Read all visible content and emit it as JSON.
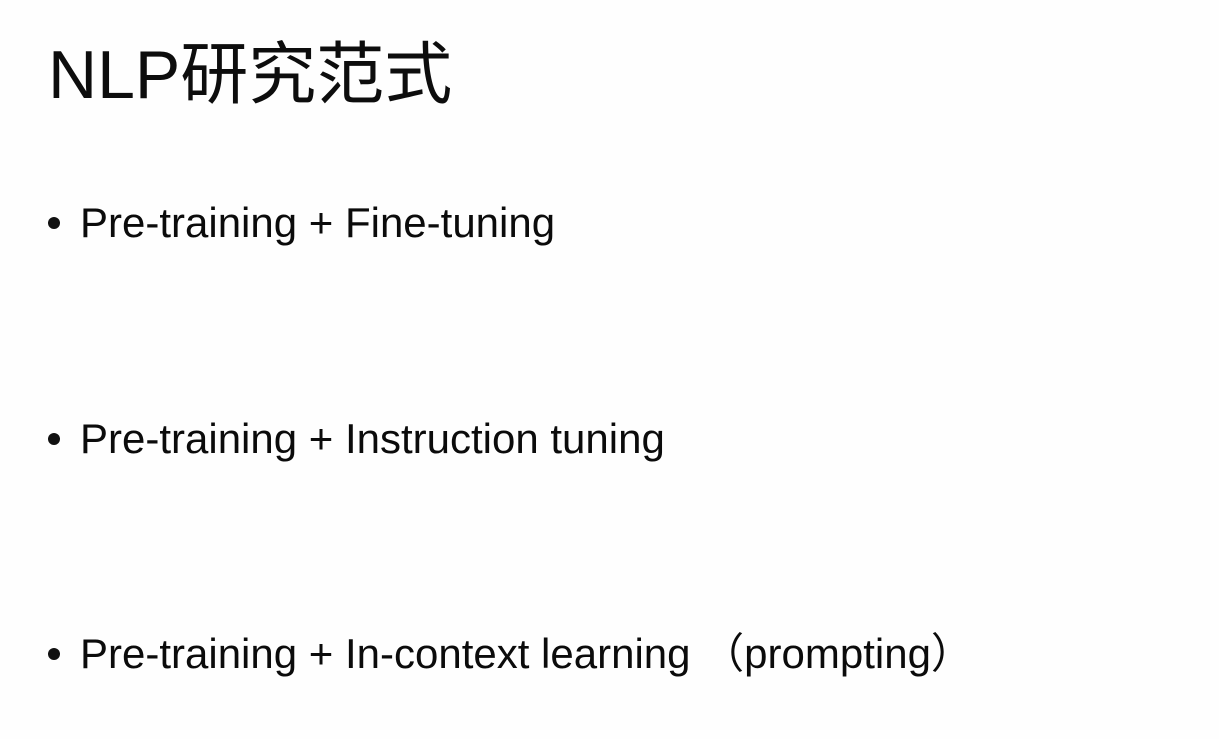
{
  "slide": {
    "title": "NLP研究范式",
    "bullets": [
      "Pre-training + Fine-tuning",
      "Pre-training + Instruction tuning",
      "Pre-training + In-context learning （prompting）"
    ]
  }
}
